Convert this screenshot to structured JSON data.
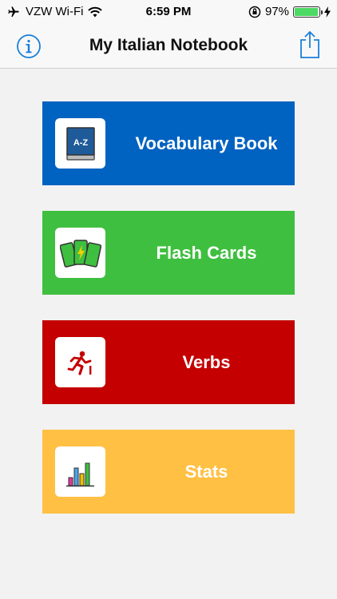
{
  "status_bar": {
    "carrier": "VZW Wi-Fi",
    "time": "6:59 PM",
    "battery_percent": "97%",
    "battery_level": 0.97,
    "icons": [
      "airplane-icon",
      "wifi-icon",
      "rotation-lock-icon",
      "battery-icon",
      "charging-bolt-icon"
    ]
  },
  "nav": {
    "title": "My Italian Notebook",
    "left_icon": "info-icon",
    "right_icon": "share-icon",
    "accent": "#1a7fd9"
  },
  "menu": {
    "items": [
      {
        "label": "Vocabulary Book",
        "icon": "vocabulary-book-icon",
        "icon_text": "A-Z",
        "color": "#0062c1"
      },
      {
        "label": "Flash Cards",
        "icon": "flash-cards-icon",
        "color": "#3fbf3f"
      },
      {
        "label": "Verbs",
        "icon": "running-person-icon",
        "color": "#c40000"
      },
      {
        "label": "Stats",
        "icon": "bar-chart-icon",
        "color": "#ffc043"
      }
    ]
  }
}
